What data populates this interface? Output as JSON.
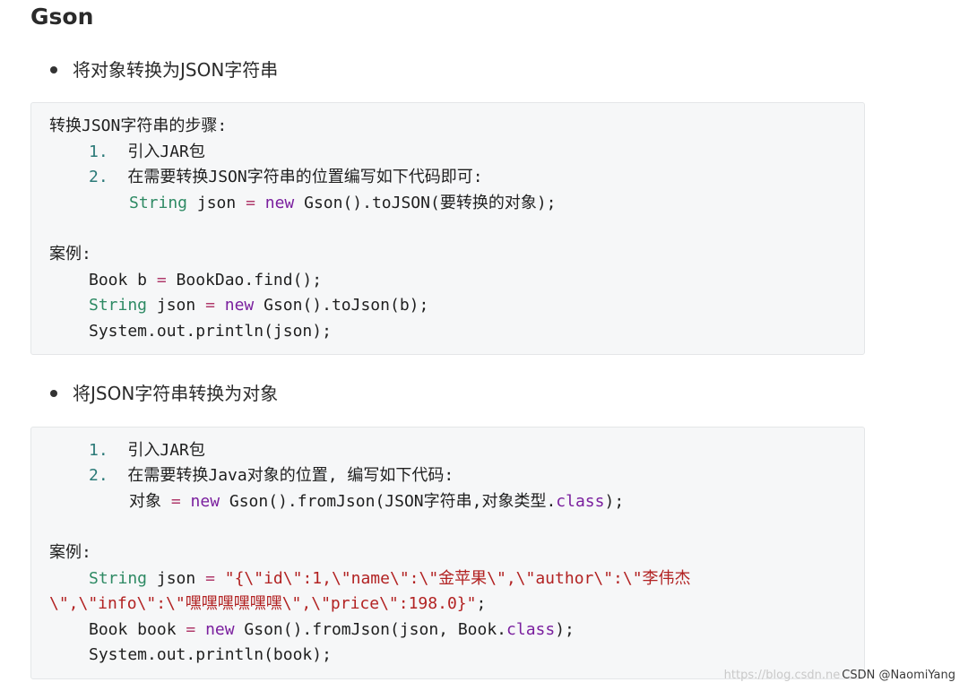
{
  "title": "Gson",
  "section1": {
    "heading": "将对象转换为JSON字符串",
    "intro": "转换JSON字符串的步骤:",
    "steps": [
      {
        "num": "1.",
        "text": "引入JAR包"
      },
      {
        "num": "2.",
        "text": "在需要转换JSON字符串的位置编写如下代码即可:"
      }
    ],
    "code_type": "String",
    "code_var": " json ",
    "code_eq": "=",
    "code_new": "new",
    "code_rest": " Gson().toJSON(要转换的对象);",
    "case_label": "案例:",
    "case_line1_a": "Book b ",
    "case_line1_eq": "=",
    "case_line1_b": " BookDao.find();",
    "case_line2_type": "String",
    "case_line2_var": " json ",
    "case_line2_eq": "=",
    "case_line2_new": "new",
    "case_line2_rest": " Gson().toJson(b);",
    "case_line3": "System.out.println(json);"
  },
  "section2": {
    "heading": "将JSON字符串转换为对象",
    "steps": [
      {
        "num": "1.",
        "text": "引入JAR包"
      },
      {
        "num": "2.",
        "text": "在需要转换Java对象的位置, 编写如下代码:"
      }
    ],
    "code_a": "对象 ",
    "code_eq": "=",
    "code_new": "new",
    "code_mid": " Gson().fromJson(JSON字符串,对象类型.",
    "code_class": "class",
    "code_end": ");",
    "case_label": "案例:",
    "case_line1_type": "String",
    "case_line1_var": " json ",
    "case_line1_eq": "=",
    "case_line1_str": "\"{\\\"id\\\":1,\\\"name\\\":\\\"金苹果\\\",\\\"author\\\":\\\"李伟杰",
    "case_line1_str2": "\\\",\\\"info\\\":\\\"嘿嘿嘿嘿嘿嘿\\\",\\\"price\\\":198.0}\"",
    "case_line1_end": ";",
    "case_line2_a": "Book book ",
    "case_line2_eq": "=",
    "case_line2_new": "new",
    "case_line2_mid": " Gson().fromJson(json, Book.",
    "case_line2_class": "class",
    "case_line2_end": ");",
    "case_line3": "System.out.println(book);"
  },
  "watermark": {
    "faint": "https://blog.csdn.ne",
    "text": "CSDN @NaomiYang"
  }
}
